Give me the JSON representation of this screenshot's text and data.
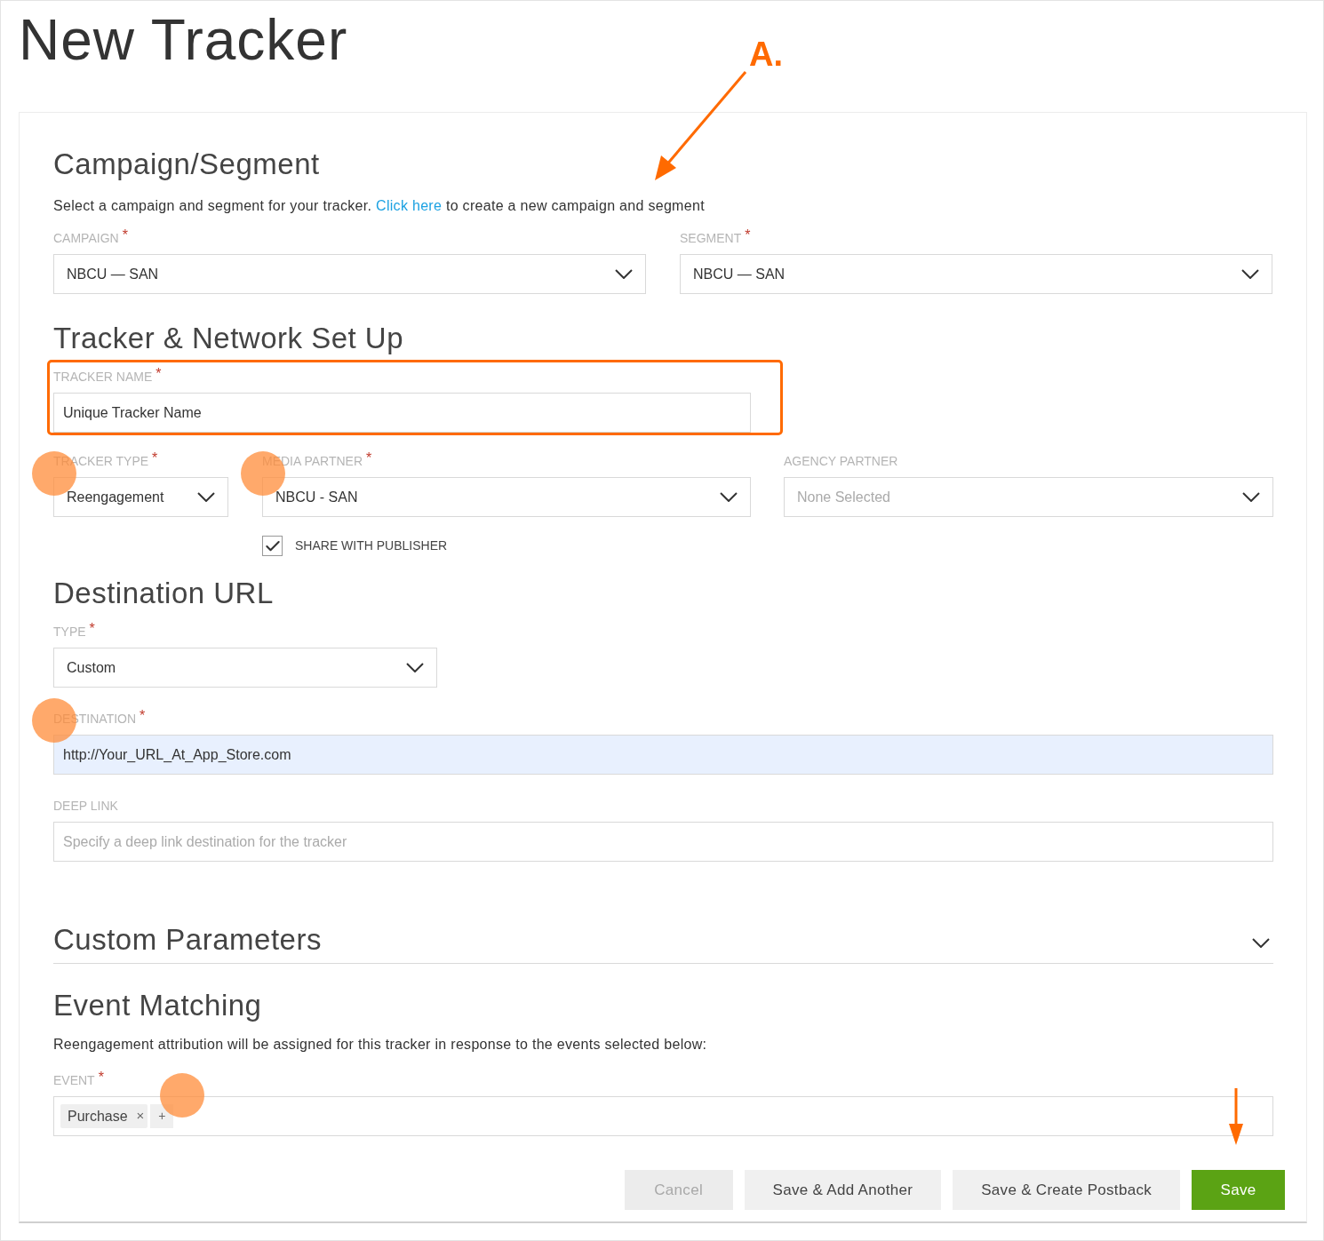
{
  "page_title": "New Tracker",
  "annotation": {
    "label": "A."
  },
  "campaign_segment": {
    "heading": "Campaign/Segment",
    "intro_before": "Select a campaign and segment for your tracker. ",
    "link": "Click here",
    "intro_after": " to create a new campaign and segment",
    "fields": [
      {
        "label": "CAMPAIGN",
        "required_mark": "*",
        "value": "NBCU — SAN"
      },
      {
        "label": "SEGMENT",
        "required_mark": "*",
        "value": "NBCU — SAN"
      }
    ]
  },
  "tracker_setup": {
    "heading": "Tracker & Network Set Up",
    "highlighted": true,
    "tracker_name": {
      "label": "TRACKER NAME",
      "required_mark": "*",
      "value": "Unique Tracker Name"
    },
    "selects": [
      {
        "label": "TRACKER TYPE",
        "required_mark": "*",
        "value": "Reengagement"
      },
      {
        "label": "MEDIA PARTNER",
        "required_mark": "*",
        "value": "NBCU - SAN"
      },
      {
        "label": "AGENCY PARTNER",
        "placeholder": "None Selected"
      }
    ],
    "share_with_publisher": {
      "label": "SHARE WITH PUBLISHER",
      "checked": true
    }
  },
  "destination_url": {
    "heading": "Destination URL",
    "type": {
      "label": "TYPE",
      "required_mark": "*",
      "value": "Custom"
    },
    "destination": {
      "label": "DESTINATION",
      "required_mark": "*",
      "value": "http://Your_URL_At_App_Store.com",
      "autofilled": true
    },
    "deep_link": {
      "label": "DEEP LINK",
      "placeholder": "Specify a deep link destination for the tracker"
    }
  },
  "custom_parameters": {
    "heading": "Custom Parameters",
    "expanded": false
  },
  "event_matching": {
    "heading": "Event Matching",
    "description": "Reengagement attribution will be assigned for this tracker in response to the events selected below:",
    "event": {
      "label": "EVENT",
      "required_mark": "*",
      "tags": [
        {
          "label": "Purchase",
          "remove": "×"
        }
      ],
      "add": "+"
    }
  },
  "buttons": [
    {
      "label": "Cancel",
      "kind": "disabled"
    },
    {
      "label": "Save & Add Another",
      "kind": "secondary"
    },
    {
      "label": "Save & Create Postback",
      "kind": "secondary"
    },
    {
      "label": "Save",
      "kind": "primary"
    }
  ]
}
